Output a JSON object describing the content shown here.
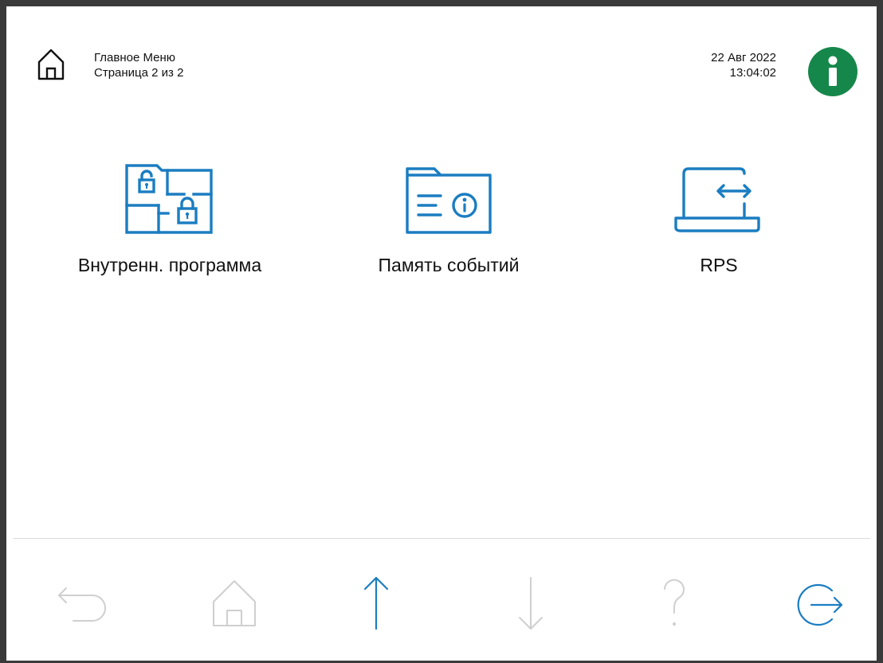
{
  "header": {
    "title": "Главное Меню",
    "subtitle": "Страница 2 из 2",
    "date": "22 Авг 2022",
    "time": "13:04:02",
    "home_icon": "home-outline-icon",
    "info_icon": "info-icon"
  },
  "tiles": [
    {
      "label": "Внутренн. программа",
      "icon": "floorplan-lock-icon"
    },
    {
      "label": "Память событий",
      "icon": "folder-info-icon"
    },
    {
      "label": "RPS",
      "icon": "laptop-transfer-icon"
    }
  ],
  "footer": {
    "back": {
      "icon": "back-arrow-icon",
      "state": "disabled"
    },
    "home": {
      "icon": "home-icon",
      "state": "disabled"
    },
    "up": {
      "icon": "arrow-up-icon",
      "state": "enabled"
    },
    "down": {
      "icon": "arrow-down-icon",
      "state": "disabled"
    },
    "help": {
      "icon": "help-icon",
      "state": "disabled"
    },
    "logout": {
      "icon": "logout-icon",
      "state": "enabled"
    }
  },
  "colors": {
    "accent": "#1b7dc1",
    "info": "#16874a",
    "disabled": "#cfcfcf",
    "frame": "#3a3a3a"
  }
}
